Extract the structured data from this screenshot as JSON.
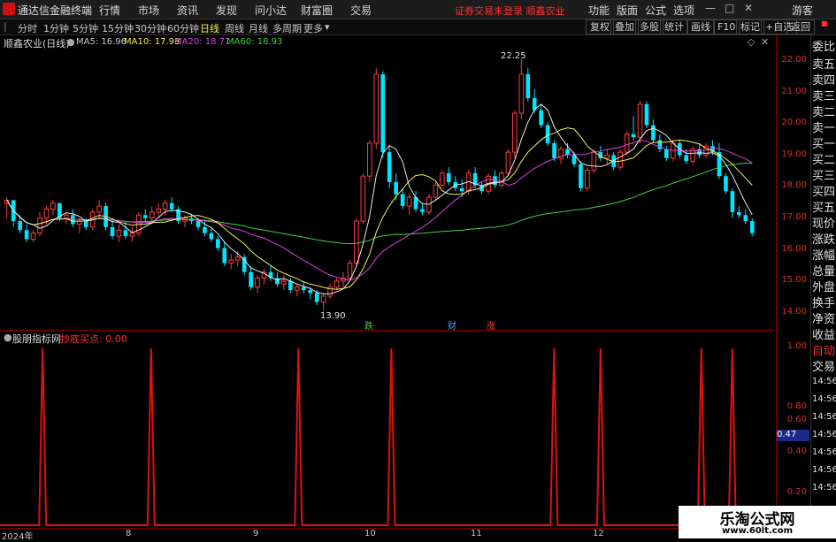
{
  "app": {
    "title": "通达信金融终端"
  },
  "menu": [
    "行情",
    "市场",
    "资讯",
    "发现",
    "问小达",
    "财富圈",
    "交易"
  ],
  "notice": "证券交易未登录  顺鑫农业",
  "right_menu": [
    "功能",
    "版面",
    "公式",
    "选项"
  ],
  "guest": "游客",
  "periods": [
    "分时",
    "1分钟",
    "5分钟",
    "15分钟",
    "30分钟",
    "60分钟",
    "日线",
    "周线",
    "月线",
    "多周期",
    "更多"
  ],
  "active_period": "日线",
  "tools": [
    "复权",
    "叠加",
    "多股",
    "统计",
    "画线",
    "F10",
    "标记",
    "+自选",
    "返回"
  ],
  "stock": {
    "label": "顺鑫农业(日线)"
  },
  "ma": [
    {
      "label": "MA5: 16.96",
      "color": "#e8e8e8"
    },
    {
      "label": "MA10: 17.98",
      "color": "#f0f060"
    },
    {
      "label": "MA20: 18.71",
      "color": "#e040e0"
    },
    {
      "label": "MA60: 18.93",
      "color": "#40d040"
    }
  ],
  "annotations": {
    "high": "22.25",
    "low": "13.90",
    "mark1": "跌",
    "mark2": "财",
    "mark3": "涨"
  },
  "indicator": {
    "name": "股朋指标网",
    "label": "抄底买点: 0.00"
  },
  "price_axis": [
    "22.00",
    "21.00",
    "20.00",
    "19.00",
    "18.00",
    "17.00",
    "16.00",
    "15.00",
    "14.00"
  ],
  "sub_axis": [
    "1.00",
    "0.80",
    "0.60",
    "0.47",
    "0.40",
    "0.20"
  ],
  "side": [
    "委比",
    "卖五",
    "卖四",
    "卖三",
    "卖二",
    "卖一",
    "买一",
    "买二",
    "买三",
    "买四",
    "买五",
    "现价",
    "涨跌",
    "涨幅",
    "总量",
    "外盘",
    "换手",
    "净资",
    "收益",
    "自动",
    "交易",
    "14:56",
    "14:56",
    "14:56",
    "14:56",
    "14:56",
    "14:56",
    "14:56"
  ],
  "dates": [
    "2024年",
    "8",
    "9",
    "10",
    "11",
    "12"
  ],
  "watermark": {
    "title": "乐淘公式网",
    "url": "www.60lt.com"
  },
  "colors": {
    "up": "#ff3b3b",
    "down": "#00e5ff",
    "signal": "#e01010"
  },
  "chart_data": {
    "type": "candlestick",
    "ylim": [
      13.6,
      22.8
    ],
    "spikes": [
      0.2,
      1.6,
      3.5,
      4.7,
      6.8,
      7.4,
      8.7,
      9.1
    ],
    "candles": [
      [
        17.5,
        17.7,
        17.0,
        17.6
      ],
      [
        17.6,
        17.6,
        16.7,
        16.9
      ],
      [
        16.9,
        17.1,
        16.5,
        16.6
      ],
      [
        16.6,
        16.8,
        16.2,
        16.3
      ],
      [
        16.3,
        16.6,
        16.2,
        16.5
      ],
      [
        16.5,
        17.2,
        16.4,
        17.0
      ],
      [
        17.0,
        17.4,
        16.8,
        17.3
      ],
      [
        17.3,
        17.6,
        17.1,
        17.5
      ],
      [
        17.5,
        17.5,
        16.9,
        17.0
      ],
      [
        17.0,
        17.2,
        16.8,
        17.1
      ],
      [
        17.1,
        17.3,
        16.7,
        16.8
      ],
      [
        16.8,
        17.0,
        16.5,
        16.9
      ],
      [
        16.9,
        17.0,
        16.6,
        16.7
      ],
      [
        16.7,
        17.3,
        16.6,
        17.2
      ],
      [
        17.2,
        17.6,
        17.0,
        17.4
      ],
      [
        17.4,
        17.5,
        16.6,
        16.7
      ],
      [
        16.7,
        17.0,
        16.3,
        16.4
      ],
      [
        16.4,
        16.8,
        16.2,
        16.6
      ],
      [
        16.6,
        16.9,
        16.3,
        16.4
      ],
      [
        16.4,
        16.7,
        16.2,
        16.5
      ],
      [
        16.5,
        17.2,
        16.4,
        17.1
      ],
      [
        17.1,
        17.3,
        16.9,
        17.0
      ],
      [
        17.0,
        17.4,
        16.8,
        17.2
      ],
      [
        17.2,
        17.5,
        17.0,
        17.3
      ],
      [
        17.3,
        17.6,
        17.1,
        17.5
      ],
      [
        17.5,
        17.7,
        17.2,
        17.3
      ],
      [
        17.3,
        17.4,
        16.8,
        16.9
      ],
      [
        16.9,
        17.1,
        16.7,
        17.0
      ],
      [
        17.0,
        17.1,
        16.8,
        16.9
      ],
      [
        16.9,
        17.0,
        16.6,
        16.7
      ],
      [
        16.7,
        16.9,
        16.4,
        16.5
      ],
      [
        16.5,
        16.7,
        16.2,
        16.3
      ],
      [
        16.3,
        16.4,
        15.9,
        16.0
      ],
      [
        16.0,
        16.2,
        15.4,
        15.5
      ],
      [
        15.5,
        15.8,
        15.3,
        15.6
      ],
      [
        15.6,
        15.9,
        15.4,
        15.7
      ],
      [
        15.7,
        15.8,
        15.1,
        15.2
      ],
      [
        15.2,
        15.4,
        14.6,
        14.7
      ],
      [
        14.7,
        15.1,
        14.5,
        15.0
      ],
      [
        15.0,
        15.3,
        14.8,
        15.2
      ],
      [
        15.2,
        15.4,
        14.9,
        15.0
      ],
      [
        15.0,
        15.2,
        14.7,
        14.8
      ],
      [
        14.8,
        15.1,
        14.6,
        14.9
      ],
      [
        14.9,
        15.0,
        14.5,
        14.6
      ],
      [
        14.6,
        14.8,
        14.4,
        14.7
      ],
      [
        14.7,
        14.9,
        14.5,
        14.6
      ],
      [
        14.6,
        14.7,
        14.3,
        14.5
      ],
      [
        14.5,
        14.6,
        14.1,
        14.2
      ],
      [
        14.2,
        14.5,
        13.9,
        14.4
      ],
      [
        14.4,
        14.8,
        14.3,
        14.7
      ],
      [
        14.7,
        15.0,
        14.6,
        14.9
      ],
      [
        14.9,
        15.2,
        14.7,
        15.0
      ],
      [
        15.0,
        15.6,
        14.9,
        15.5
      ],
      [
        15.5,
        17.0,
        15.4,
        16.9
      ],
      [
        16.9,
        18.5,
        16.8,
        18.4
      ],
      [
        18.4,
        19.6,
        18.2,
        19.5
      ],
      [
        19.5,
        22.0,
        19.3,
        21.8
      ],
      [
        21.8,
        21.9,
        19.0,
        19.2
      ],
      [
        19.2,
        19.4,
        18.0,
        18.2
      ],
      [
        18.2,
        18.5,
        17.6,
        17.8
      ],
      [
        17.8,
        18.0,
        17.3,
        17.4
      ],
      [
        17.4,
        17.8,
        17.1,
        17.7
      ],
      [
        17.7,
        17.9,
        17.2,
        17.3
      ],
      [
        17.3,
        17.5,
        17.1,
        17.2
      ],
      [
        17.2,
        17.8,
        17.1,
        17.7
      ],
      [
        17.7,
        18.2,
        17.6,
        18.1
      ],
      [
        18.1,
        18.6,
        18.0,
        18.5
      ],
      [
        18.5,
        18.7,
        18.1,
        18.2
      ],
      [
        18.2,
        18.4,
        17.9,
        18.0
      ],
      [
        18.0,
        18.3,
        17.7,
        17.9
      ],
      [
        17.9,
        18.6,
        17.8,
        18.5
      ],
      [
        18.5,
        18.7,
        18.0,
        18.1
      ],
      [
        18.1,
        18.2,
        17.8,
        17.9
      ],
      [
        17.9,
        18.5,
        17.8,
        18.4
      ],
      [
        18.4,
        18.6,
        18.0,
        18.1
      ],
      [
        18.1,
        18.6,
        18.0,
        18.5
      ],
      [
        18.5,
        19.3,
        18.4,
        19.2
      ],
      [
        19.2,
        20.6,
        19.0,
        20.5
      ],
      [
        20.5,
        22.3,
        20.3,
        21.8
      ],
      [
        21.8,
        22.0,
        20.9,
        21.0
      ],
      [
        21.0,
        21.3,
        20.5,
        20.6
      ],
      [
        20.6,
        20.8,
        20.0,
        20.1
      ],
      [
        20.1,
        20.2,
        19.4,
        19.5
      ],
      [
        19.5,
        19.6,
        18.9,
        19.0
      ],
      [
        19.0,
        19.4,
        18.8,
        19.3
      ],
      [
        19.3,
        19.5,
        19.0,
        19.1
      ],
      [
        19.1,
        19.2,
        18.7,
        18.8
      ],
      [
        18.8,
        18.9,
        17.9,
        18.0
      ],
      [
        18.0,
        18.7,
        17.9,
        18.6
      ],
      [
        18.6,
        19.3,
        18.5,
        19.2
      ],
      [
        19.2,
        19.4,
        18.9,
        19.0
      ],
      [
        19.0,
        19.3,
        18.8,
        19.1
      ],
      [
        19.1,
        19.2,
        18.6,
        18.7
      ],
      [
        18.7,
        19.3,
        18.6,
        19.2
      ],
      [
        19.2,
        19.9,
        19.1,
        19.8
      ],
      [
        19.8,
        20.4,
        19.6,
        19.7
      ],
      [
        19.7,
        20.9,
        19.5,
        20.8
      ],
      [
        20.8,
        20.9,
        20.0,
        20.1
      ],
      [
        20.1,
        20.3,
        19.5,
        19.6
      ],
      [
        19.6,
        19.8,
        19.2,
        19.3
      ],
      [
        19.3,
        19.4,
        18.9,
        19.0
      ],
      [
        19.0,
        19.6,
        18.9,
        19.5
      ],
      [
        19.5,
        19.6,
        19.0,
        19.1
      ],
      [
        19.1,
        19.3,
        18.8,
        18.9
      ],
      [
        18.9,
        19.4,
        18.8,
        19.3
      ],
      [
        19.3,
        19.5,
        19.0,
        19.1
      ],
      [
        19.1,
        19.5,
        19.0,
        19.4
      ],
      [
        19.4,
        19.6,
        19.1,
        19.2
      ],
      [
        19.2,
        19.5,
        18.3,
        18.4
      ],
      [
        18.4,
        18.5,
        17.8,
        17.9
      ],
      [
        17.9,
        18.0,
        17.0,
        17.2
      ],
      [
        17.2,
        17.4,
        17.0,
        17.1
      ],
      [
        17.1,
        17.3,
        16.8,
        16.9
      ],
      [
        16.9,
        17.0,
        16.4,
        16.5
      ]
    ]
  }
}
